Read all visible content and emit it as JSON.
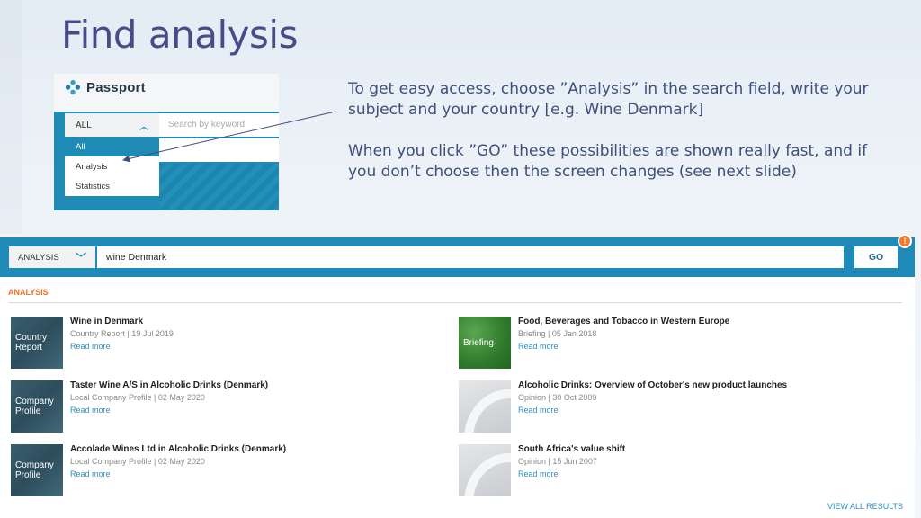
{
  "slide": {
    "title": "Find analysis",
    "instructions": [
      "To get easy access, choose ”Analysis” in the search field, write your subject and your country [e.g. Wine Denmark]",
      "When you click ”GO” these possibilities are shown really fast, and if you don’t choose then the screen changes (see next slide)"
    ]
  },
  "mini_screenshot": {
    "logo": "Passport",
    "select_value": "ALL",
    "search_placeholder": "Search by keyword",
    "options": [
      "All",
      "Analysis",
      "Statistics"
    ]
  },
  "search_screenshot": {
    "select_value": "ANALYSIS",
    "search_value": "wine Denmark",
    "go_label": "GO",
    "badge": "!",
    "section_heading": "ANALYSIS",
    "view_all": "VIEW ALL RESULTS",
    "results": [
      {
        "title": "Wine in Denmark",
        "meta": "Country Report | 19 Jul 2019",
        "link": "Read more",
        "thumb": "Country Report"
      },
      {
        "title": "Food, Beverages and Tobacco in Western Europe",
        "meta": "Briefing | 05 Jan 2018",
        "link": "Read more",
        "thumb": "Briefing"
      },
      {
        "title": "Taster Wine A/S in Alcoholic Drinks (Denmark)",
        "meta": "Local Company Profile | 02 May 2020",
        "link": "Read more",
        "thumb": "Company Profile"
      },
      {
        "title": "Alcoholic Drinks: Overview of October's new product launches",
        "meta": "Opinion | 30 Oct 2009",
        "link": "Read more",
        "thumb": ""
      },
      {
        "title": "Accolade Wines Ltd in Alcoholic Drinks (Denmark)",
        "meta": "Local Company Profile | 02 May 2020",
        "link": "Read more",
        "thumb": "Company Profile"
      },
      {
        "title": "South Africa's value shift",
        "meta": "Opinion | 15 Jun 2007",
        "link": "Read more",
        "thumb": ""
      }
    ]
  },
  "colors": {
    "title": "#4a4a8a",
    "brand_blue": "#1e8ab5",
    "accent_orange": "#e8742e",
    "link_blue": "#2a8fc4"
  }
}
